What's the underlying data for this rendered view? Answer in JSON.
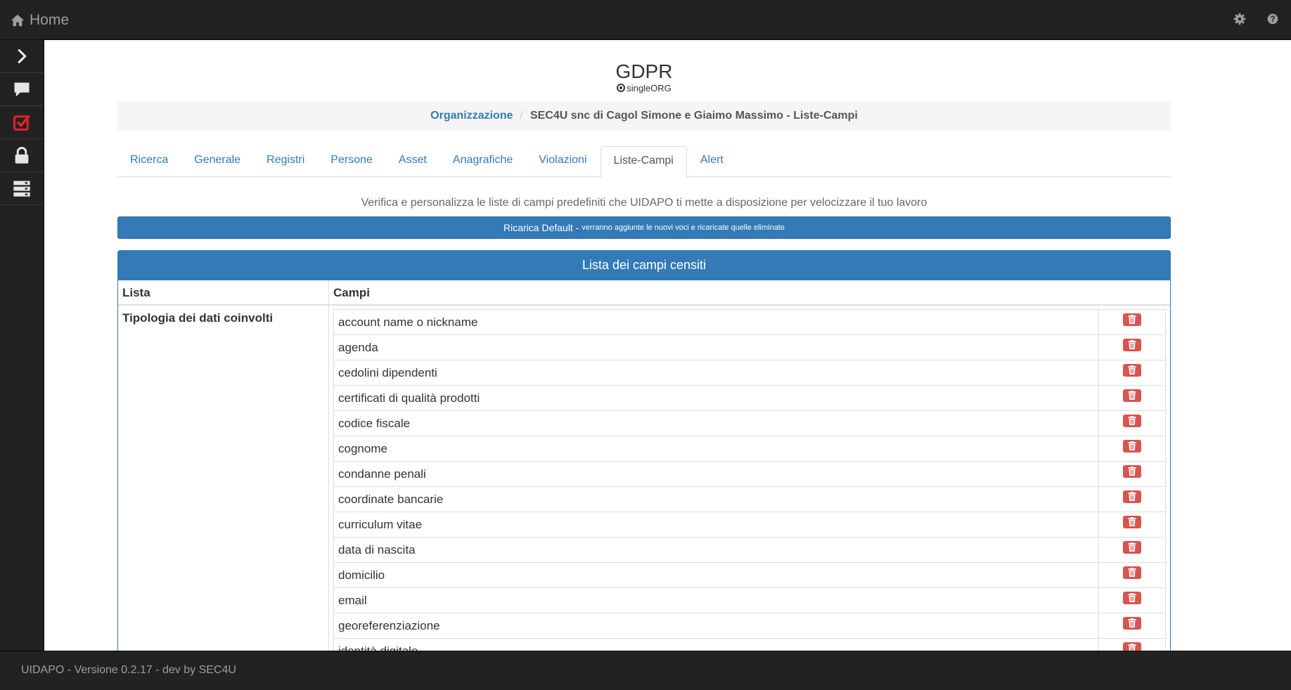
{
  "topbar": {
    "home_label": "Home",
    "icons": [
      "home-icon",
      "gear-icon",
      "help-icon"
    ]
  },
  "sidebar": {
    "items": [
      {
        "icon": "chevron-right-icon"
      },
      {
        "icon": "comment-icon"
      },
      {
        "icon": "checkbox-icon",
        "color": "#e8202a"
      },
      {
        "icon": "lock-icon"
      },
      {
        "icon": "server-icon"
      }
    ]
  },
  "header": {
    "title": "GDPR",
    "subtitle": "singleORG"
  },
  "breadcrumb": {
    "link": "Organizzazione",
    "current": "SEC4U snc di Cagol Simone e Giaimo Massimo - Liste-Campi"
  },
  "tabs": [
    {
      "label": "Ricerca"
    },
    {
      "label": "Generale"
    },
    {
      "label": "Registri"
    },
    {
      "label": "Persone"
    },
    {
      "label": "Asset"
    },
    {
      "label": "Anagrafiche"
    },
    {
      "label": "Violazioni"
    },
    {
      "label": "Liste-Campi",
      "active": true
    },
    {
      "label": "Alert"
    }
  ],
  "description": "Verifica e personalizza le liste di campi predefiniti che UIDAPO ti mette a disposizione per velocizzare il tuo lavoro",
  "reload_button": {
    "label": "Ricarica Default -",
    "note": "verranno aggiunte le nuovi voci e ricaricate quelle eliminate"
  },
  "panel": {
    "title": "Lista dei campi censiti",
    "col_lista": "Lista",
    "col_campi": "Campi",
    "list_name": "Tipologia dei dati coinvolti",
    "fields": [
      "account name o nickname",
      "agenda",
      "cedolini dipendenti",
      "certificati di qualità prodotti",
      "codice fiscale",
      "cognome",
      "condanne penali",
      "coordinate bancarie",
      "curriculum vitae",
      "data di nascita",
      "domicilio",
      "email",
      "georeferenziazione",
      "identità digitale"
    ]
  },
  "footer": {
    "text": "UIDAPO - Versione 0.2.17 - dev by SEC4U"
  },
  "colors": {
    "primary": "#337ab7",
    "danger": "#d9534f",
    "navbar": "#222222"
  }
}
